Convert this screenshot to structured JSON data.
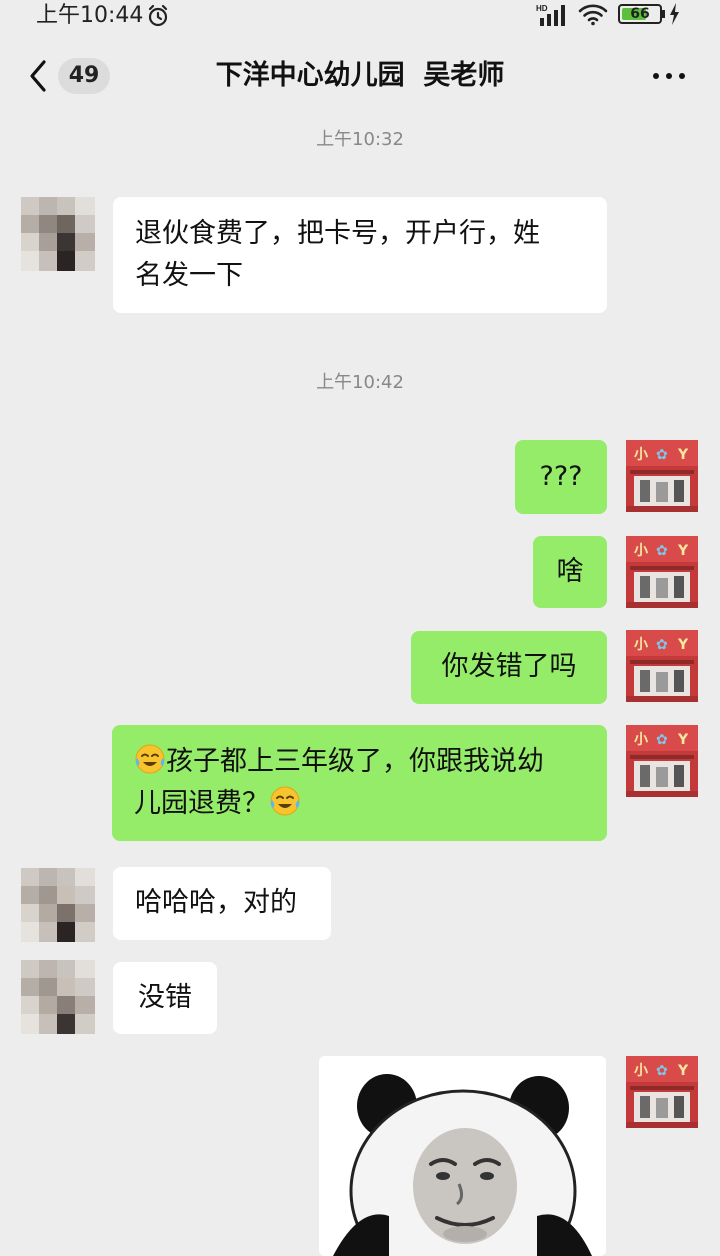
{
  "status_bar": {
    "time": "上午10:44",
    "network": "HD",
    "battery": "66",
    "battery_level": 0.66
  },
  "header": {
    "back_icon": "chevron-left-icon",
    "unread_count": "49",
    "title": "下洋中心幼儿园  吴老师",
    "more_icon": "ellipsis-icon"
  },
  "messages": [
    {
      "type": "timestamp",
      "text": "上午10:32"
    },
    {
      "type": "message",
      "side": "left",
      "lines": [
        "退伙食费了，把卡号，开户行，姓",
        "名发一下"
      ]
    },
    {
      "type": "timestamp",
      "text": "上午10:42"
    },
    {
      "type": "message",
      "side": "right",
      "text": "???"
    },
    {
      "type": "message",
      "side": "right",
      "text": "啥"
    },
    {
      "type": "message",
      "side": "right",
      "text": "你发错了吗"
    },
    {
      "type": "message",
      "side": "right",
      "lines": [
        "孩子都上三年级了，你跟我说幼",
        "儿园退费？"
      ],
      "emoji": "face-with-tears-of-joy-emoji"
    },
    {
      "type": "message",
      "side": "left",
      "text": "哈哈哈，对的"
    },
    {
      "type": "message",
      "side": "left",
      "text": "没错"
    },
    {
      "type": "sticker",
      "side": "right",
      "sticker": "panda-meme-sticker"
    }
  ],
  "colors": {
    "background": "#ededed",
    "bubble_self": "#95ec69",
    "bubble_other": "#ffffff",
    "timestamp": "#888888"
  }
}
